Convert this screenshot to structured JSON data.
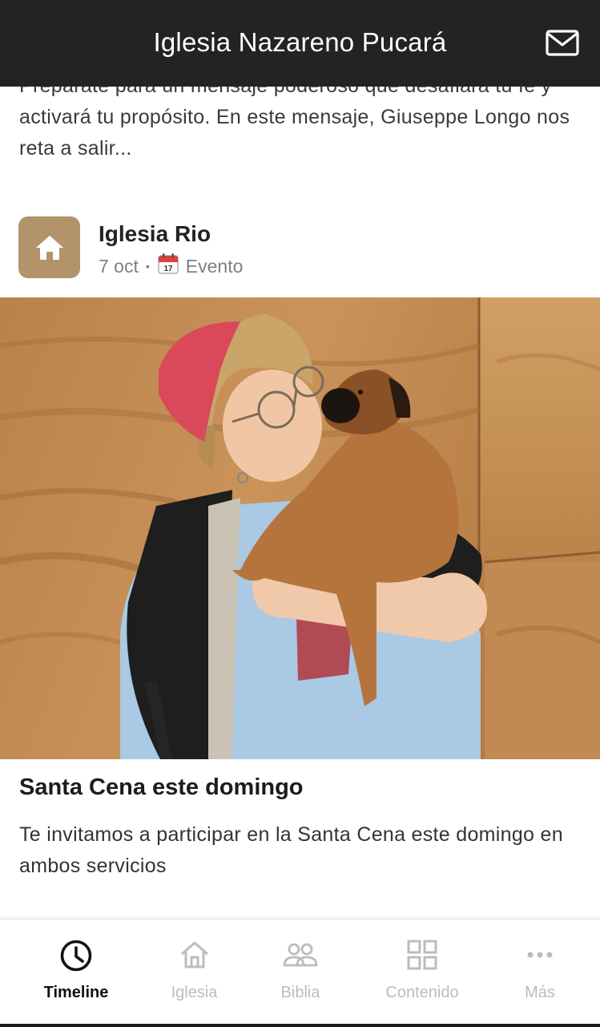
{
  "header": {
    "title": "Iglesia Nazareno Pucará",
    "mail_icon": "mail-icon"
  },
  "previous_post": {
    "excerpt": "Prepárate para un mensaje poderoso que desafiará tu fe y activará tu propósito. En este mensaje, Giuseppe Longo nos reta a salir..."
  },
  "post": {
    "avatar_icon": "home-icon",
    "avatar_color": "#b3936a",
    "author": "Iglesia Rio",
    "date": "7 oct",
    "separator": "•",
    "calendar_icon": "calendar-icon",
    "type": "Evento",
    "title": "Santa Cena este domingo",
    "body": "Te invitamos a participar en la Santa Cena este domingo en ambos servicios"
  },
  "nav": {
    "items": [
      {
        "label": "Timeline",
        "icon": "clock-icon",
        "active": true
      },
      {
        "label": "Iglesia",
        "icon": "home-icon",
        "active": false
      },
      {
        "label": "Biblia",
        "icon": "people-icon",
        "active": false
      },
      {
        "label": "Contenido",
        "icon": "grid-icon",
        "active": false
      },
      {
        "label": "Más",
        "icon": "more-icon",
        "active": false
      }
    ]
  },
  "colors": {
    "header_bg": "#232325",
    "accent": "#b3936a",
    "nav_inactive": "#bcbcbc",
    "nav_active": "#111111"
  }
}
